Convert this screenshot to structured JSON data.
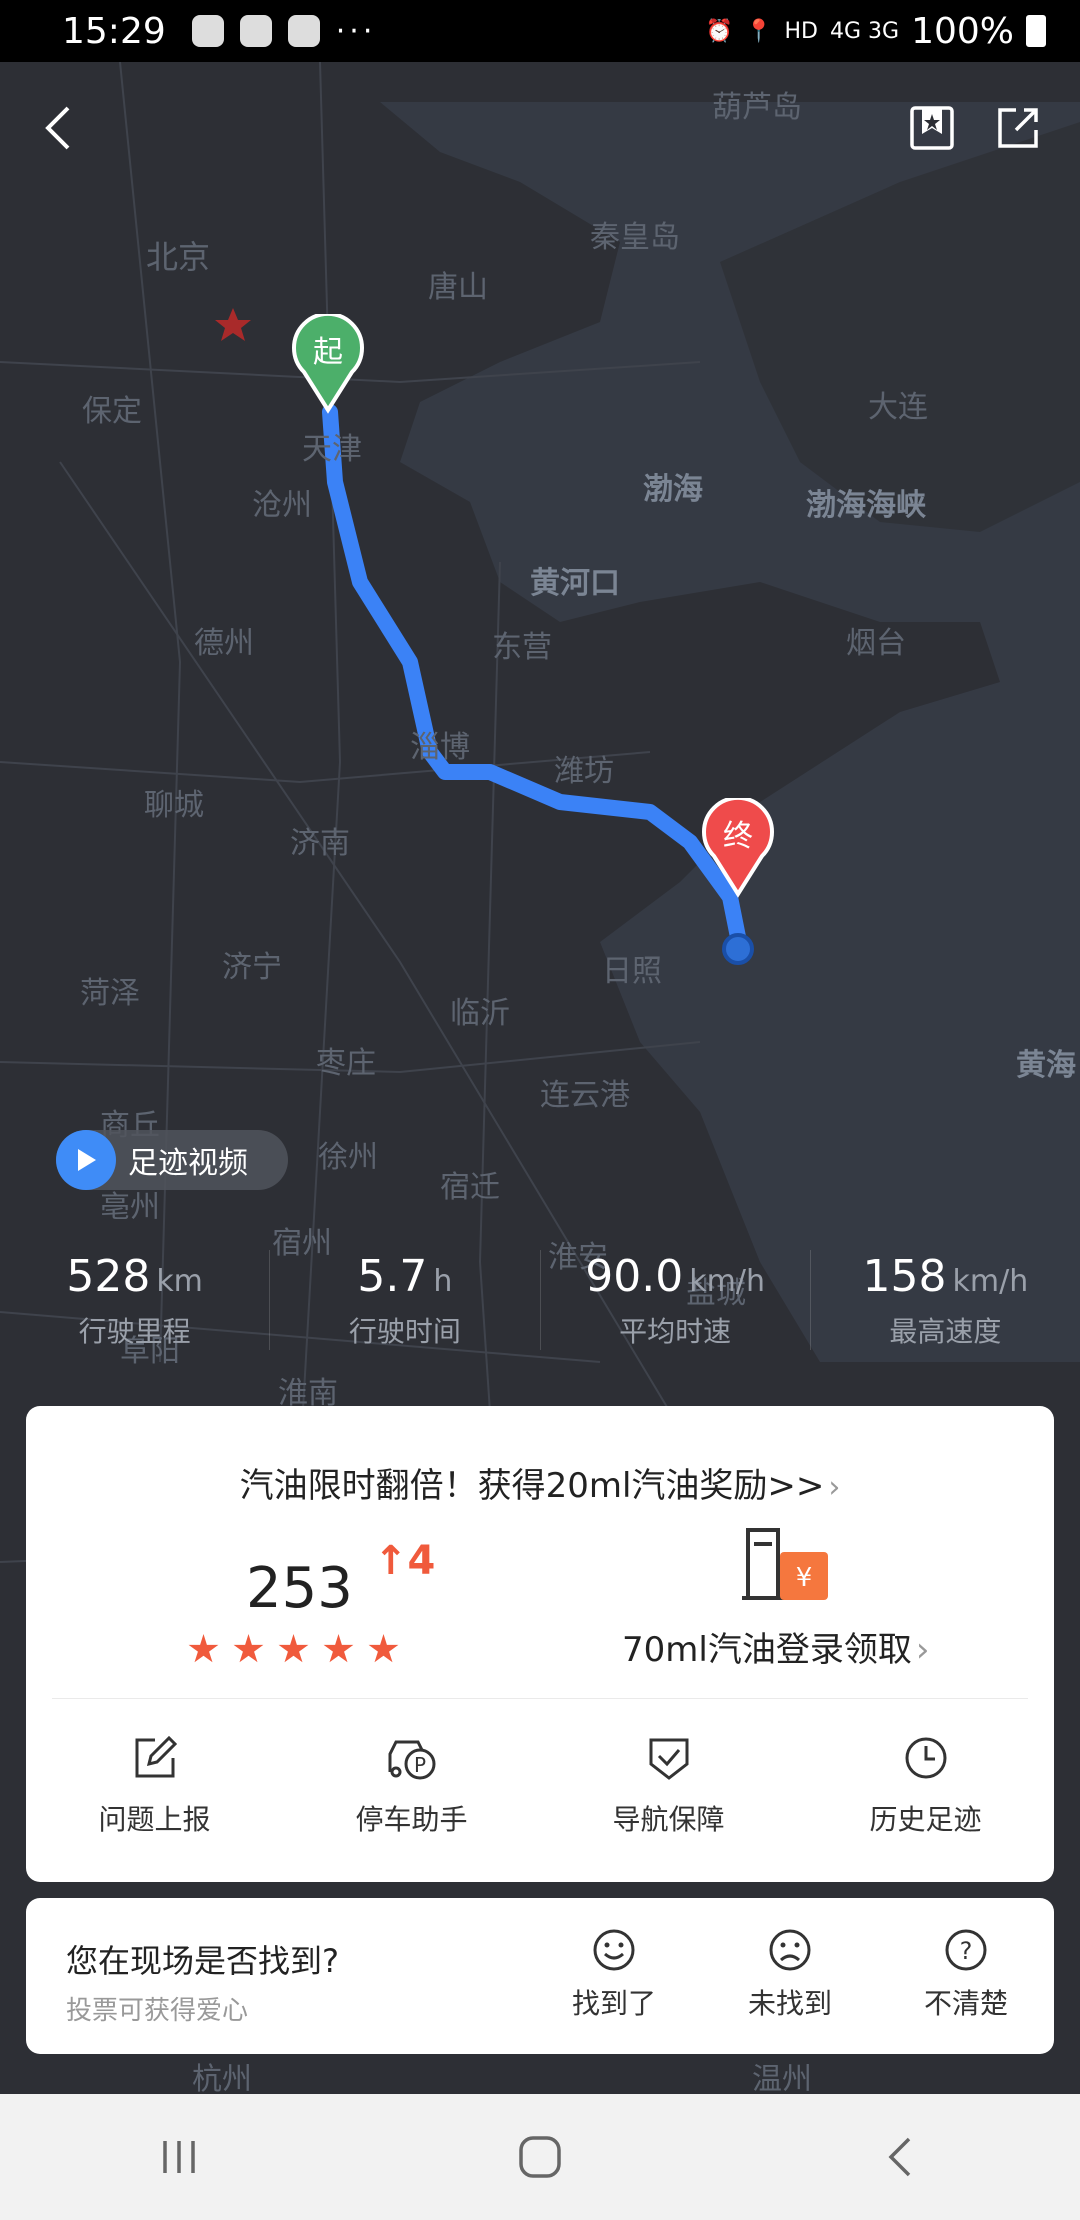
{
  "status_bar": {
    "time": "15:29",
    "network": "HD",
    "signal": "4G 3G",
    "battery": "100%"
  },
  "map": {
    "labels": {
      "beijing": "北京",
      "huludao": "葫芦岛",
      "qinhuangdao": "秦皇岛",
      "tangshan": "唐山",
      "baoding": "保定",
      "tianjin": "天津",
      "cangzhou": "沧州",
      "bohai": "渤海",
      "bohai_strait": "渤海海峡",
      "dalian": "大连",
      "huanghekou": "黄河口",
      "dongying": "东营",
      "yantai": "烟台",
      "dezhou": "德州",
      "zibo": "淄博",
      "weifang": "潍坊",
      "liaocheng": "聊城",
      "jinan": "济南",
      "jining": "济宁",
      "rizhao": "日照",
      "heze": "菏泽",
      "linyi": "临沂",
      "zaozhuang": "枣庄",
      "lianyungang": "连云港",
      "xuzhou": "徐州",
      "suqian": "宿迁",
      "huaian": "淮安",
      "suzhou_ah": "宿州",
      "huainan": "淮南",
      "bozhou": "亳州",
      "fuyang": "阜阳",
      "shangqiu": "商丘",
      "huanghai": "黄海",
      "yancheng": "盐城",
      "wenzhou": "温州",
      "hangzhou": "杭州"
    },
    "start_marker": "起",
    "end_marker": "终",
    "route_color": "#3b82f6"
  },
  "video_chip": {
    "label": "足迹视频"
  },
  "stats": [
    {
      "value": "528",
      "unit": "km",
      "label": "行驶里程"
    },
    {
      "value": "5.7",
      "unit": "h",
      "label": "行驶时间"
    },
    {
      "value": "90.0",
      "unit": "km/h",
      "label": "平均时速"
    },
    {
      "value": "158",
      "unit": "km/h",
      "label": "最高速度"
    }
  ],
  "card": {
    "promo": "汽油限时翻倍！获得20ml汽油奖励>>",
    "score": "253",
    "score_change": "4",
    "stars": 5,
    "gas_reward": "70ml汽油登录领取",
    "actions": [
      {
        "icon": "edit-icon",
        "label": "问题上报"
      },
      {
        "icon": "parking-icon",
        "label": "停车助手"
      },
      {
        "icon": "shield-check-icon",
        "label": "导航保障"
      },
      {
        "icon": "clock-icon",
        "label": "历史足迹"
      }
    ]
  },
  "found_card": {
    "question": "您在现场是否找到?",
    "subtitle": "投票可获得爱心",
    "options": [
      {
        "icon": "smile-icon",
        "label": "找到了"
      },
      {
        "icon": "frown-icon",
        "label": "未找到"
      },
      {
        "icon": "question-icon",
        "label": "不清楚"
      }
    ]
  },
  "colors": {
    "accent": "#f05a3c",
    "route": "#3b82f6",
    "start": "#4caf6a",
    "end": "#ef4b4b"
  }
}
